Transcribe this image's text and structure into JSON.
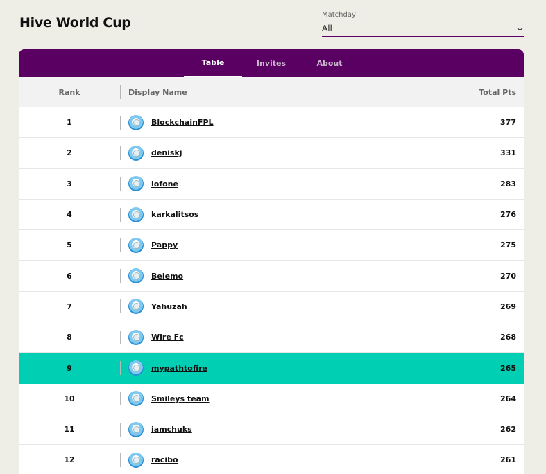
{
  "page": {
    "title": "Hive World Cup"
  },
  "matchday": {
    "label": "Matchday",
    "value": "All"
  },
  "tabs": [
    {
      "label": "Table"
    },
    {
      "label": "Invites"
    },
    {
      "label": "About"
    }
  ],
  "table": {
    "headers": {
      "rank": "Rank",
      "name": "Display Name",
      "points": "Total Pts"
    },
    "rows": [
      {
        "rank": "1",
        "name": "BlockchainFPL",
        "points": "377"
      },
      {
        "rank": "2",
        "name": "deniskj",
        "points": "331"
      },
      {
        "rank": "3",
        "name": "lofone",
        "points": "283"
      },
      {
        "rank": "4",
        "name": "karkalitsos",
        "points": "276"
      },
      {
        "rank": "5",
        "name": "Pappy",
        "points": "275"
      },
      {
        "rank": "6",
        "name": "Belemo",
        "points": "270"
      },
      {
        "rank": "7",
        "name": "Yahuzah",
        "points": "269"
      },
      {
        "rank": "8",
        "name": "Wire Fc",
        "points": "268"
      },
      {
        "rank": "9",
        "name": "mypathtofire",
        "points": "265"
      },
      {
        "rank": "10",
        "name": "Smileys team",
        "points": "264"
      },
      {
        "rank": "11",
        "name": "iamchuks",
        "points": "262"
      },
      {
        "rank": "12",
        "name": "racibo",
        "points": "261"
      }
    ]
  },
  "colors": {
    "tabbar": "#5a0062",
    "highlight_row": "#00cfb3",
    "background": "#eeede6"
  },
  "icons": {
    "avatar": "user-avatar-icon",
    "dropdown": "chevron-down-icon"
  }
}
